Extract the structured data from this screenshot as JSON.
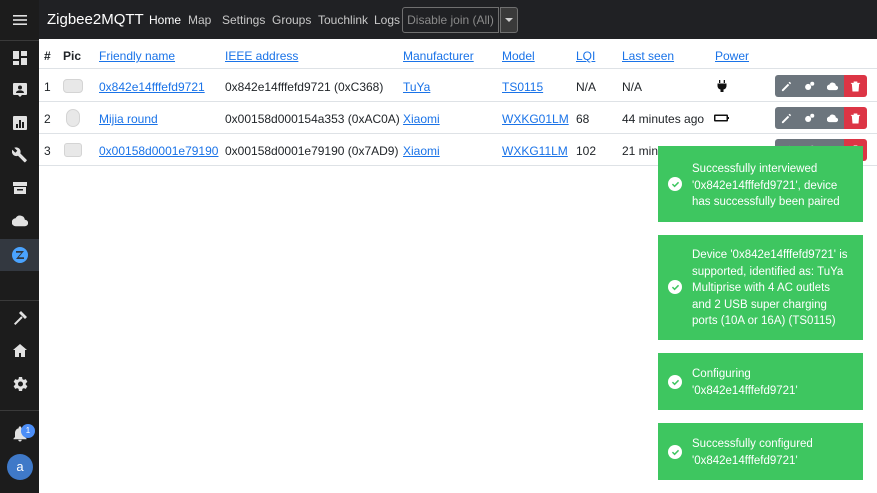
{
  "navbar": {
    "brand": "Zigbee2MQTT",
    "links": [
      "Home",
      "Map",
      "Settings",
      "Groups",
      "Touchlink",
      "Logs"
    ],
    "join_button": "Disable join (All)"
  },
  "sidebar": {
    "icons": [
      "menu-icon",
      "dashboard-icon",
      "account-box-icon",
      "chart-icon",
      "wrench-icon",
      "hacs-icon",
      "cloud-icon",
      "zigbee-icon",
      "hammer-icon",
      "home-settings-icon",
      "gear-icon",
      "bell-icon"
    ],
    "notification_count": "1",
    "avatar_letter": "a"
  },
  "table": {
    "headers": [
      "#",
      "Pic",
      "Friendly name",
      "IEEE address",
      "Manufacturer",
      "Model",
      "LQI",
      "Last seen",
      "Power"
    ],
    "rows": [
      {
        "num": "1",
        "friendly_name": "0x842e14fffefd9721",
        "ieee": "0x842e14fffefd9721 (0xC368)",
        "manufacturer": "TuYa",
        "model": "TS0115",
        "lqi": "N/A",
        "last_seen": "N/A",
        "power": "plug-icon"
      },
      {
        "num": "2",
        "friendly_name": "Mijia round",
        "ieee": "0x00158d000154a353 (0xAC0A)",
        "manufacturer": "Xiaomi",
        "model": "WXKG01LM",
        "lqi": "68",
        "last_seen": "44 minutes ago",
        "power": "battery-icon"
      },
      {
        "num": "3",
        "friendly_name": "0x00158d0001e79190",
        "ieee": "0x00158d0001e79190 (0x7AD9)",
        "manufacturer": "Xiaomi",
        "model": "WXKG11LM",
        "lqi": "102",
        "last_seen": "21 minutes ago",
        "power": "battery-icon"
      }
    ]
  },
  "toasts": [
    "Successfully interviewed '0x842e14fffefd9721', device has successfully been paired",
    "Device '0x842e14fffefd9721' is supported, identified as: TuYa Multiprise with 4 AC outlets and 2 USB super charging ports (10A or 16A) (TS0115)",
    "Configuring '0x842e14fffefd9721'",
    "Successfully configured '0x842e14fffefd9721'"
  ],
  "colors": {
    "sidebar_bg": "#1c1c1c",
    "navbar_bg": "#202124",
    "link": "#1a73e8",
    "toast_success": "#3ec660",
    "delete_button": "#dc3545",
    "action_button": "#6c757d"
  }
}
